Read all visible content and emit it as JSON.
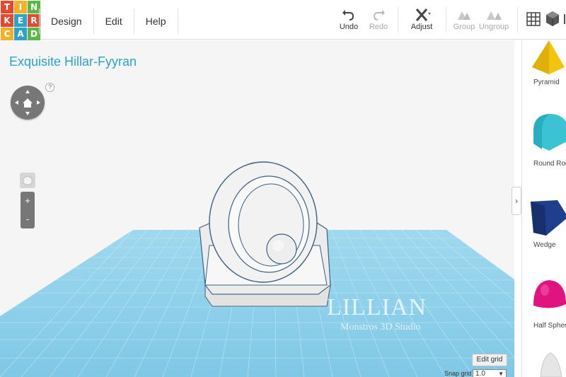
{
  "logo": {
    "letters": [
      "T",
      "I",
      "N",
      "K",
      "E",
      "R",
      "C",
      "A",
      "D"
    ]
  },
  "menu": {
    "design": "Design",
    "edit": "Edit",
    "help": "Help"
  },
  "toolbar": {
    "undo": "Undo",
    "redo": "Redo",
    "adjust": "Adjust",
    "group": "Group",
    "ungroup": "Ungroup"
  },
  "design_title": "Exquisite Hillar-Fyyran",
  "view_controls": {
    "help": "?",
    "zoom_in": "+",
    "zoom_out": "-"
  },
  "grid": {
    "edit_grid_label": "Edit grid",
    "snap_label": "Snap grid",
    "snap_value": "1.0"
  },
  "watermark": {
    "name": "LILLIAN",
    "subtitle": "Monstros 3D Studio"
  },
  "shapes": [
    {
      "label": "Pyramid",
      "color": "#f2c40f"
    },
    {
      "label": "Round Roof",
      "color": "#3cc3d3"
    },
    {
      "label": "Wedge",
      "color": "#1f3e8c"
    },
    {
      "label": "Half Sphere",
      "color": "#e0137f"
    },
    {
      "label": "",
      "color": "#e6e6e6"
    }
  ],
  "colors": {
    "logo_tiles": [
      "#e2492f",
      "#f2b12b",
      "#5bb847",
      "#e2492f",
      "#2ea2c8",
      "#e2492f",
      "#f2b12b",
      "#2ea2c8",
      "#5bb847"
    ],
    "grid_blue": "#8fd0e8",
    "title_teal": "#2aa3c6"
  },
  "panel_toggle": "›"
}
